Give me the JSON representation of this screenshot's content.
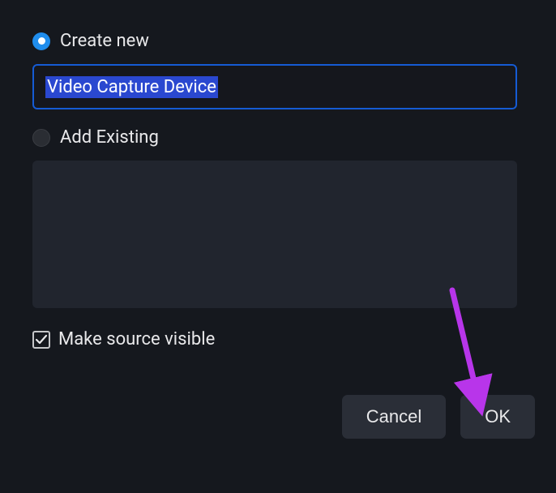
{
  "radios": {
    "create_new": {
      "label": "Create new",
      "selected": true
    },
    "add_existing": {
      "label": "Add Existing",
      "selected": false
    }
  },
  "name_input": {
    "value": "Video Capture Device"
  },
  "checkbox": {
    "label": "Make source visible",
    "checked": true
  },
  "buttons": {
    "cancel": "Cancel",
    "ok": "OK"
  },
  "annotation": {
    "arrow_color": "#b835ea"
  }
}
